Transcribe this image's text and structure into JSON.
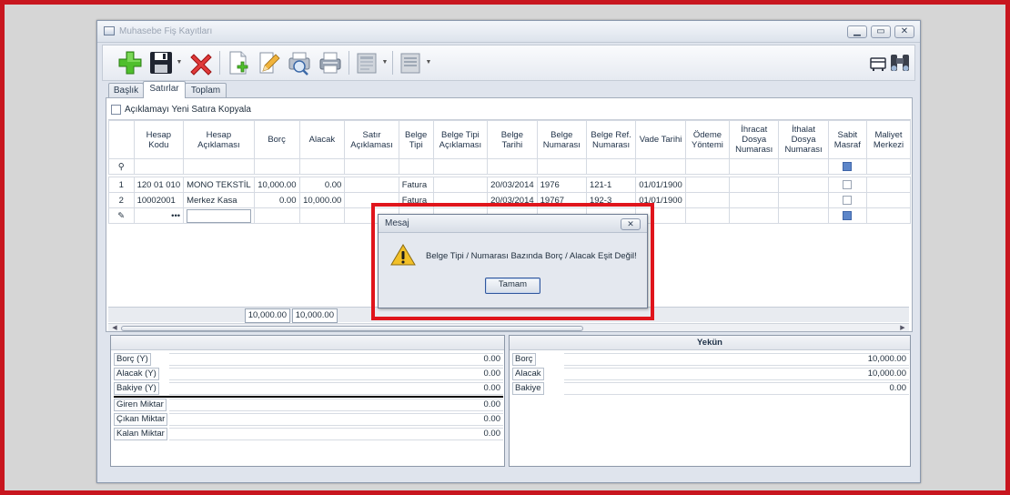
{
  "window": {
    "title": "Muhasebe Fiş Kayıtları",
    "controls": {
      "minimize": "▁",
      "maximize": "▭",
      "close": "✕"
    }
  },
  "toolbar": {
    "icons": [
      "add-icon",
      "save-icon",
      "delete-icon",
      "new-document-icon",
      "edit-icon",
      "print-preview-icon",
      "print-icon",
      "report-icon",
      "list-icon",
      "receipt-icon",
      "binoculars-icon"
    ]
  },
  "tabs": [
    {
      "label": "Başlık",
      "active": false
    },
    {
      "label": "Satırlar",
      "active": true
    },
    {
      "label": "Toplam",
      "active": false
    }
  ],
  "copy_checkbox": {
    "label": "Açıklamayı Yeni Satıra Kopyala",
    "checked": false
  },
  "grid": {
    "columns": [
      "",
      "Hesap Kodu",
      "Hesap Açıklaması",
      "Borç",
      "Alacak",
      "Satır Açıklaması",
      "Belge Tipi",
      "Belge Tipi Açıklaması",
      "Belge Tarihi",
      "Belge Numarası",
      "Belge Ref. Numarası",
      "Vade Tarihi",
      "Ödeme Yöntemi",
      "İhracat Dosya Numarası",
      "İthalat Dosya Numarası",
      "Sabit Masraf",
      "Maliyet Merkezi"
    ],
    "filter_marker": "⚲",
    "rows": [
      {
        "no": "1",
        "hesap_kodu": "120 01 010",
        "hesap_aciklamasi": "MONO TEKSTİL",
        "borc": "10,000.00",
        "alacak": "0.00",
        "satir_aciklamasi": "",
        "belge_tipi": "Fatura",
        "belge_tipi_aciklamasi": "",
        "belge_tarihi": "20/03/2014",
        "belge_numarasi": "1976",
        "belge_ref": "121-1",
        "vade_tarihi": "01/01/1900"
      },
      {
        "no": "2",
        "hesap_kodu": "10002001",
        "hesap_aciklamasi": "Merkez Kasa",
        "borc": "0.00",
        "alacak": "10,000.00",
        "satir_aciklamasi": "",
        "belge_tipi": "Fatura",
        "belge_tipi_aciklamasi": "",
        "belge_tarihi": "20/03/2014",
        "belge_numarasi": "19767",
        "belge_ref": "192-3",
        "vade_tarihi": "01/01/1900"
      }
    ],
    "new_row": {
      "marker": "✎",
      "lookup": "•••"
    },
    "totals": {
      "borc": "10,000.00",
      "alacak": "10,000.00"
    }
  },
  "left_panel": {
    "rows": [
      {
        "label": "Borç (Y)",
        "value": "0.00"
      },
      {
        "label": "Alacak (Y)",
        "value": "0.00"
      },
      {
        "label": "Bakiye (Y)",
        "value": "0.00"
      },
      {
        "label": "Giren Miktar",
        "value": "0.00"
      },
      {
        "label": "Çıkan Miktar",
        "value": "0.00"
      },
      {
        "label": "Kalan Miktar",
        "value": "0.00"
      }
    ]
  },
  "right_panel": {
    "title": "Yekün",
    "rows": [
      {
        "label": "Borç",
        "value": "10,000.00"
      },
      {
        "label": "Alacak",
        "value": "10,000.00"
      },
      {
        "label": "Bakiye",
        "value": "0.00"
      }
    ]
  },
  "dialog": {
    "title": "Mesaj",
    "close": "✕",
    "icon": "warning-icon",
    "message": "Belge Tipi / Numarası Bazında Borç / Alacak Eşit Değil!",
    "ok_label": "Tamam"
  },
  "colors": {
    "highlight": "#e0151c",
    "accent_border": "#30579e",
    "warning": "#f2c028"
  }
}
